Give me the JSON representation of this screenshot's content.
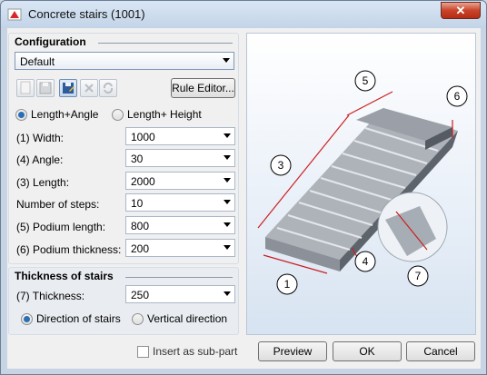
{
  "window": {
    "title": "Concrete stairs (1001)",
    "close_label": "✕"
  },
  "configuration": {
    "header": "Configuration",
    "selected": "Default",
    "rule_editor_label": "Rule Editor..."
  },
  "mode": {
    "option1": "Length+Angle",
    "option2": "Length+ Height",
    "selected": "Length+Angle"
  },
  "params": [
    {
      "label": "(1) Width:",
      "value": "1000"
    },
    {
      "label": "(4) Angle:",
      "value": "30"
    },
    {
      "label": "(3) Length:",
      "value": "2000"
    },
    {
      "label": "Number of steps:",
      "value": "10"
    },
    {
      "label": "(5) Podium length:",
      "value": "800"
    },
    {
      "label": "(6) Podium thickness:",
      "value": "200"
    }
  ],
  "thickness": {
    "header": "Thickness of stairs",
    "label": "(7) Thickness:",
    "value": "250",
    "option1": "Direction of stairs",
    "option2": "Vertical direction",
    "selected": "Direction of stairs"
  },
  "diagram": {
    "labels": [
      "1",
      "3",
      "4",
      "5",
      "6",
      "7"
    ]
  },
  "footer": {
    "subpart_label": "Insert as sub-part",
    "subpart_checked": false,
    "preview_label": "Preview",
    "ok_label": "OK",
    "cancel_label": "Cancel"
  }
}
